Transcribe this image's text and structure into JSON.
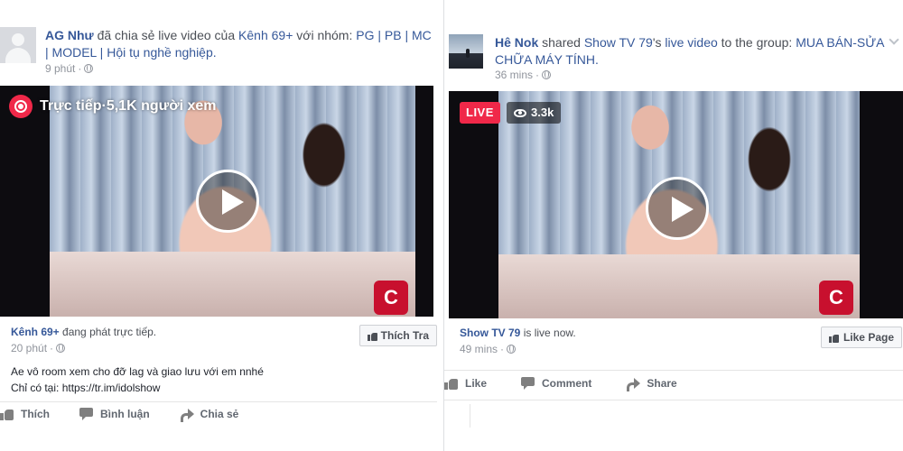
{
  "left_post": {
    "actor": "AG Như",
    "verb": " đã chia sẻ live video của ",
    "page": "Kênh 69+",
    "connector": " với nhóm: ",
    "group": "PG | PB | MC | MODEL | Hội tụ nghề nghiệp.",
    "time": "9 phút",
    "video": {
      "live_label": "Trực tiếp",
      "separator": " · ",
      "viewers": "5,1K người xem"
    },
    "info": {
      "page": "Kênh 69+",
      "status": " đang phát trực tiếp.",
      "time": "20 phút",
      "like_page": "Thích Tra"
    },
    "message_line1": "Ae vô room xem cho đỡ lag và giao lưu với em nnhé",
    "message_line2": "Chỉ có tại: https://tr.im/idolshow",
    "actions": {
      "like": "Thích",
      "comment": "Bình luận",
      "share": "Chia sẻ"
    }
  },
  "right_post": {
    "actor": "Hê Nok",
    "verb": " shared ",
    "page": "Show TV 79",
    "possessive": "'s ",
    "object": "live video",
    "connector": " to the group: ",
    "group": "MUA BÁN-SỬA CHỮA MÁY TÍNH.",
    "time": "36 mins",
    "video": {
      "live_badge": "LIVE",
      "viewers": "3.3k"
    },
    "info": {
      "page": "Show TV 79",
      "status": " is live now.",
      "time": "49 mins",
      "like_page": "Like Page"
    },
    "actions": {
      "like": "Like",
      "comment": "Comment",
      "share": "Share"
    }
  },
  "icons": {
    "globe": "globe-icon",
    "live": "live-broadcast-icon",
    "eye": "eye-icon",
    "play": "play-icon",
    "like": "thumbs-up-icon",
    "comment": "comment-icon",
    "share": "share-arrow-icon"
  },
  "colors": {
    "link": "#365899",
    "live_red": "#f02849",
    "muted": "#90949c",
    "action_text": "#616770"
  }
}
